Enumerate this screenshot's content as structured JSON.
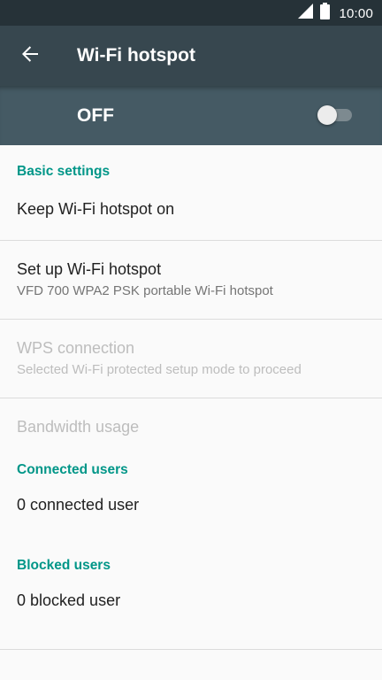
{
  "status_bar": {
    "time": "10:00",
    "icons": [
      "signal-icon",
      "battery-icon"
    ]
  },
  "app_bar": {
    "title": "Wi-Fi hotspot",
    "back_icon": "arrow-back-icon"
  },
  "master_switch": {
    "label": "OFF",
    "state": "off"
  },
  "colors": {
    "status_bar": "#263238",
    "app_bar": "#37474f",
    "switch_bar": "#455a64",
    "accent": "#009688",
    "background": "#fafafa"
  },
  "sections": {
    "basic": {
      "header": "Basic settings",
      "keep_on": {
        "title": "Keep Wi-Fi hotspot on"
      },
      "setup": {
        "title": "Set up Wi-Fi hotspot",
        "summary": "VFD 700 WPA2 PSK portable Wi-Fi hotspot"
      },
      "wps": {
        "title": "WPS connection",
        "summary": "Selected Wi-Fi protected setup mode to proceed"
      },
      "bandwidth": {
        "title": "Bandwidth usage"
      }
    },
    "connected": {
      "header": "Connected users",
      "item": {
        "title": "0 connected user"
      }
    },
    "blocked": {
      "header": "Blocked users",
      "item": {
        "title": "0 blocked user"
      }
    }
  }
}
